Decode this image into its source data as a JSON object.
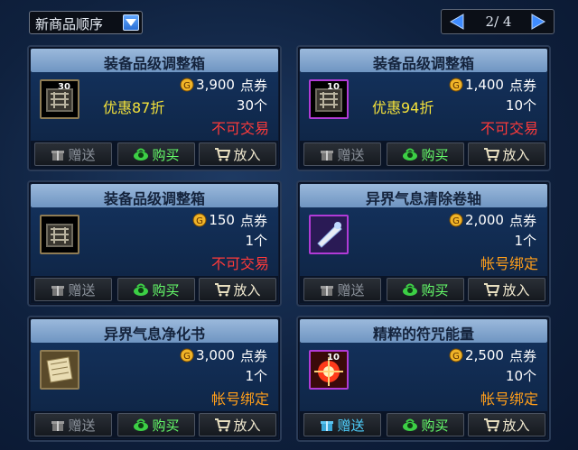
{
  "toolbar": {
    "sort_label": "新商品顺序",
    "page_indicator": "2/ 4"
  },
  "buttons": {
    "gift": "赠送",
    "buy": "购买",
    "cart": "放入"
  },
  "items": [
    {
      "title": "装备品级调整箱",
      "badge": "30",
      "price": "3,900",
      "unit": "点券",
      "qty": "30个",
      "discount": "优惠87折",
      "status": "不可交易"
    },
    {
      "title": "装备品级调整箱",
      "badge": "10",
      "price": "1,400",
      "unit": "点券",
      "qty": "10个",
      "discount": "优惠94折",
      "status": "不可交易"
    },
    {
      "title": "装备品级调整箱",
      "badge": "",
      "price": "150",
      "unit": "点券",
      "qty": "1个",
      "discount": "",
      "status": "不可交易"
    },
    {
      "title": "异界气息清除卷轴",
      "badge": "",
      "price": "2,000",
      "unit": "点券",
      "qty": "1个",
      "discount": "",
      "status": "帐号绑定"
    },
    {
      "title": "异界气息净化书",
      "badge": "",
      "price": "3,000",
      "unit": "点券",
      "qty": "1个",
      "discount": "",
      "status": "帐号绑定"
    },
    {
      "title": "精粹的符咒能量",
      "badge": "10",
      "price": "2,500",
      "unit": "点券",
      "qty": "10个",
      "discount": "",
      "status": "帐号绑定"
    }
  ],
  "colors": {
    "untradeable": "#ff3a3a",
    "account_bound": "#ff9e1a",
    "discount": "#f3e13a",
    "buy_button": "#66ff6a"
  }
}
